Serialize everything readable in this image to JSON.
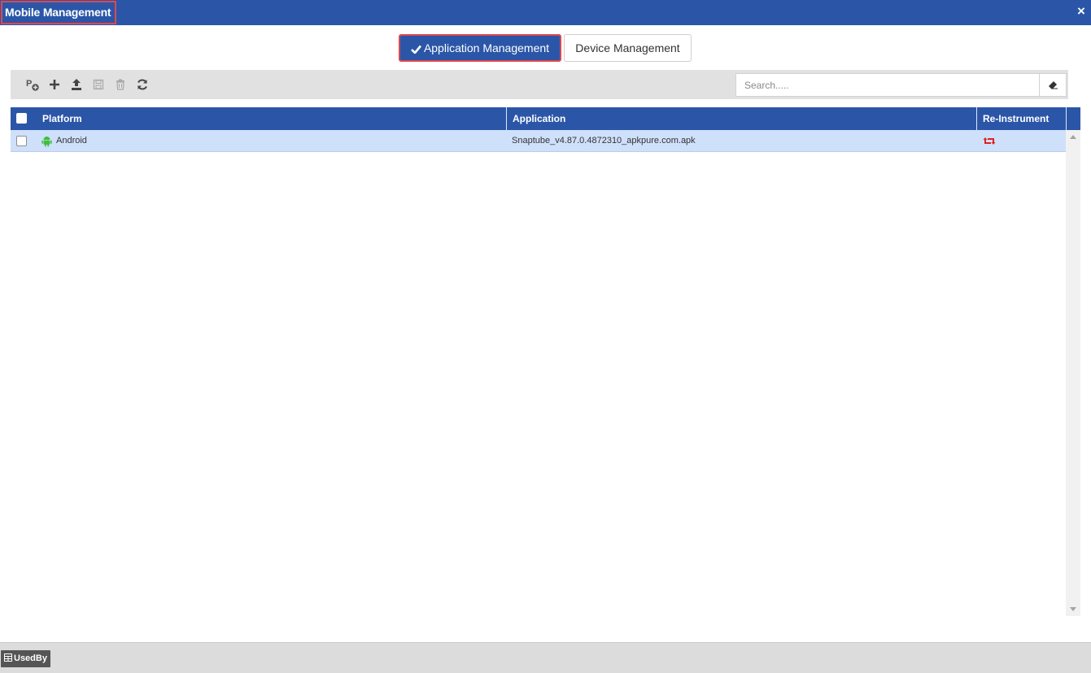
{
  "window": {
    "title": "Mobile Management",
    "close_label": "×"
  },
  "tabs": [
    {
      "label": "Application Management",
      "active": true
    },
    {
      "label": "Device Management",
      "active": false
    }
  ],
  "toolbar": {
    "icons": [
      "add-platform-icon",
      "plus-icon",
      "upload-icon",
      "save-icon",
      "trash-icon",
      "refresh-icon"
    ],
    "search_placeholder": "Search....."
  },
  "grid": {
    "columns": [
      "Platform",
      "Application",
      "Re-Instrument"
    ],
    "rows": [
      {
        "platform": "Android",
        "platform_icon": "android-icon",
        "application": "Snaptube_v4.87.0.4872310_apkpure.com.apk",
        "reinstrument_icon": "retweet-icon"
      }
    ]
  },
  "footer": {
    "usedby_label": "UsedBy"
  },
  "colors": {
    "header_blue": "#2b56a8",
    "highlight_red": "#e0474c",
    "row_selected": "#cfe0fb",
    "android_green": "#3fbf3f",
    "reinstrument_red": "#e02020"
  }
}
